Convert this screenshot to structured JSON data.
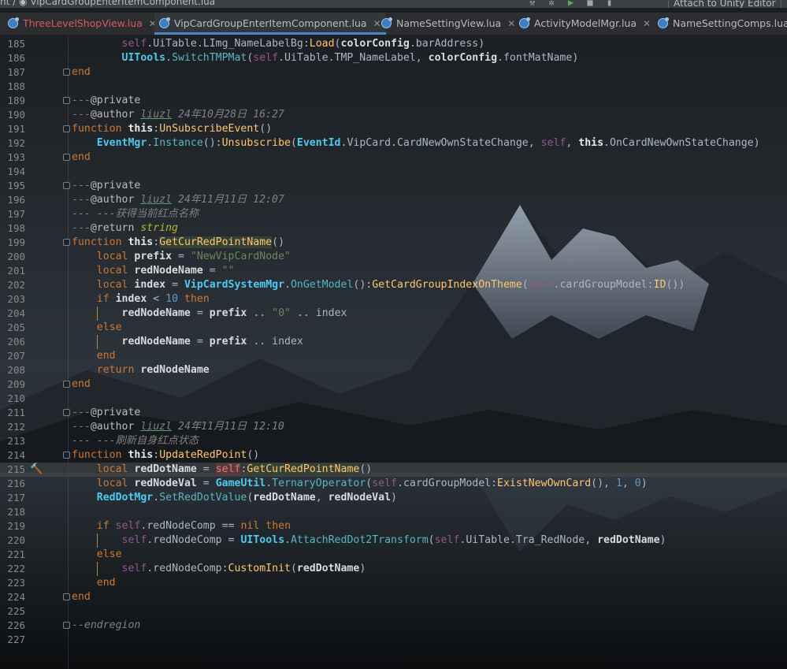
{
  "window": {
    "breadcrumb_prefix": "nt /",
    "breadcrumb_file": "VipCardGroupEnterItemComponent.lua",
    "attach_button": "Attach to Unity Editor"
  },
  "tabs": [
    {
      "label": "ThreeLevelShopView.lua",
      "active": false,
      "modified": true
    },
    {
      "label": "VipCardGroupEnterItemComponent.lua",
      "active": true,
      "modified": false
    },
    {
      "label": "NameSettingView.lua",
      "active": false,
      "modified": false
    },
    {
      "label": "ActivityModelMgr.lua",
      "active": false,
      "modified": false
    },
    {
      "label": "NameSettingComps.lua",
      "active": false,
      "modified": false
    }
  ],
  "editor": {
    "current_line": 215,
    "lines": [
      {
        "n": "185",
        "text": "        self.UiTable.LImg_NameLabelBg:Load(colorConfig.barAddress)"
      },
      {
        "n": "186",
        "text": "        UITools.SwitchTMPMat(self.UiTable.TMP_NameLabel, colorConfig.fontMatName)"
      },
      {
        "n": "187",
        "text": "end"
      },
      {
        "n": "188",
        "text": ""
      },
      {
        "n": "189",
        "text": "---@private"
      },
      {
        "n": "190",
        "text": "---@author liuzl 24年10月28日 16:27"
      },
      {
        "n": "191",
        "text": "function this:UnSubscribeEvent()"
      },
      {
        "n": "192",
        "text": "    EventMgr.Instance():Unsubscribe(EventId.VipCard.CardNewOwnStateChange, self, this.OnCardNewOwnStateChange)"
      },
      {
        "n": "193",
        "text": "end"
      },
      {
        "n": "194",
        "text": ""
      },
      {
        "n": "195",
        "text": "---@private"
      },
      {
        "n": "196",
        "text": "---@author liuzl 24年11月11日 12:07"
      },
      {
        "n": "197",
        "text": "--- ---获得当前红点名称"
      },
      {
        "n": "198",
        "text": "---@return string"
      },
      {
        "n": "199",
        "text": "function this:GetCurRedPointName()"
      },
      {
        "n": "200",
        "text": "    local prefix = \"NewVipCardNode\""
      },
      {
        "n": "201",
        "text": "    local redNodeName = \"\""
      },
      {
        "n": "202",
        "text": "    local index = VipCardSystemMgr.OnGetModel():GetCardGroupIndexOnTheme(self.cardGroupModel:ID())"
      },
      {
        "n": "203",
        "text": "    if index < 10 then"
      },
      {
        "n": "204",
        "text": "        redNodeName = prefix .. \"0\" .. index"
      },
      {
        "n": "205",
        "text": "    else"
      },
      {
        "n": "206",
        "text": "        redNodeName = prefix .. index"
      },
      {
        "n": "207",
        "text": "    end"
      },
      {
        "n": "208",
        "text": "    return redNodeName"
      },
      {
        "n": "209",
        "text": "end"
      },
      {
        "n": "210",
        "text": ""
      },
      {
        "n": "211",
        "text": "---@private"
      },
      {
        "n": "212",
        "text": "---@author liuzl 24年11月11日 12:10"
      },
      {
        "n": "213",
        "text": "--- ---刷新自身红点状态"
      },
      {
        "n": "214",
        "text": "function this:UpdateRedPoint()"
      },
      {
        "n": "215",
        "text": "    local redDotName = self:GetCurRedPointName()"
      },
      {
        "n": "216",
        "text": "    local redNodeVal = GameUtil.TernaryOperator(self.cardGroupModel:ExistNewOwnCard(), 1, 0)"
      },
      {
        "n": "217",
        "text": "    RedDotMgr.SetRedDotValue(redDotName, redNodeVal)"
      },
      {
        "n": "218",
        "text": ""
      },
      {
        "n": "219",
        "text": "    if self.redNodeComp == nil then"
      },
      {
        "n": "220",
        "text": "        self.redNodeComp = UITools.AttachRedDot2Transform(self.UiTable.Tra_RedNode, redDotName)"
      },
      {
        "n": "221",
        "text": "    else"
      },
      {
        "n": "222",
        "text": "        self.redNodeComp:CustomInit(redDotName)"
      },
      {
        "n": "223",
        "text": "    end"
      },
      {
        "n": "224",
        "text": "end"
      },
      {
        "n": "225",
        "text": ""
      },
      {
        "n": "226",
        "text": "--endregion"
      },
      {
        "n": "227",
        "text": ""
      }
    ]
  },
  "colors": {
    "keyword": "#cc7832",
    "function_name": "#ffc66d",
    "self": "#94558d",
    "string": "#6a8759",
    "number": "#6897bb",
    "comment": "#808080",
    "class": "#4ec9f0"
  }
}
